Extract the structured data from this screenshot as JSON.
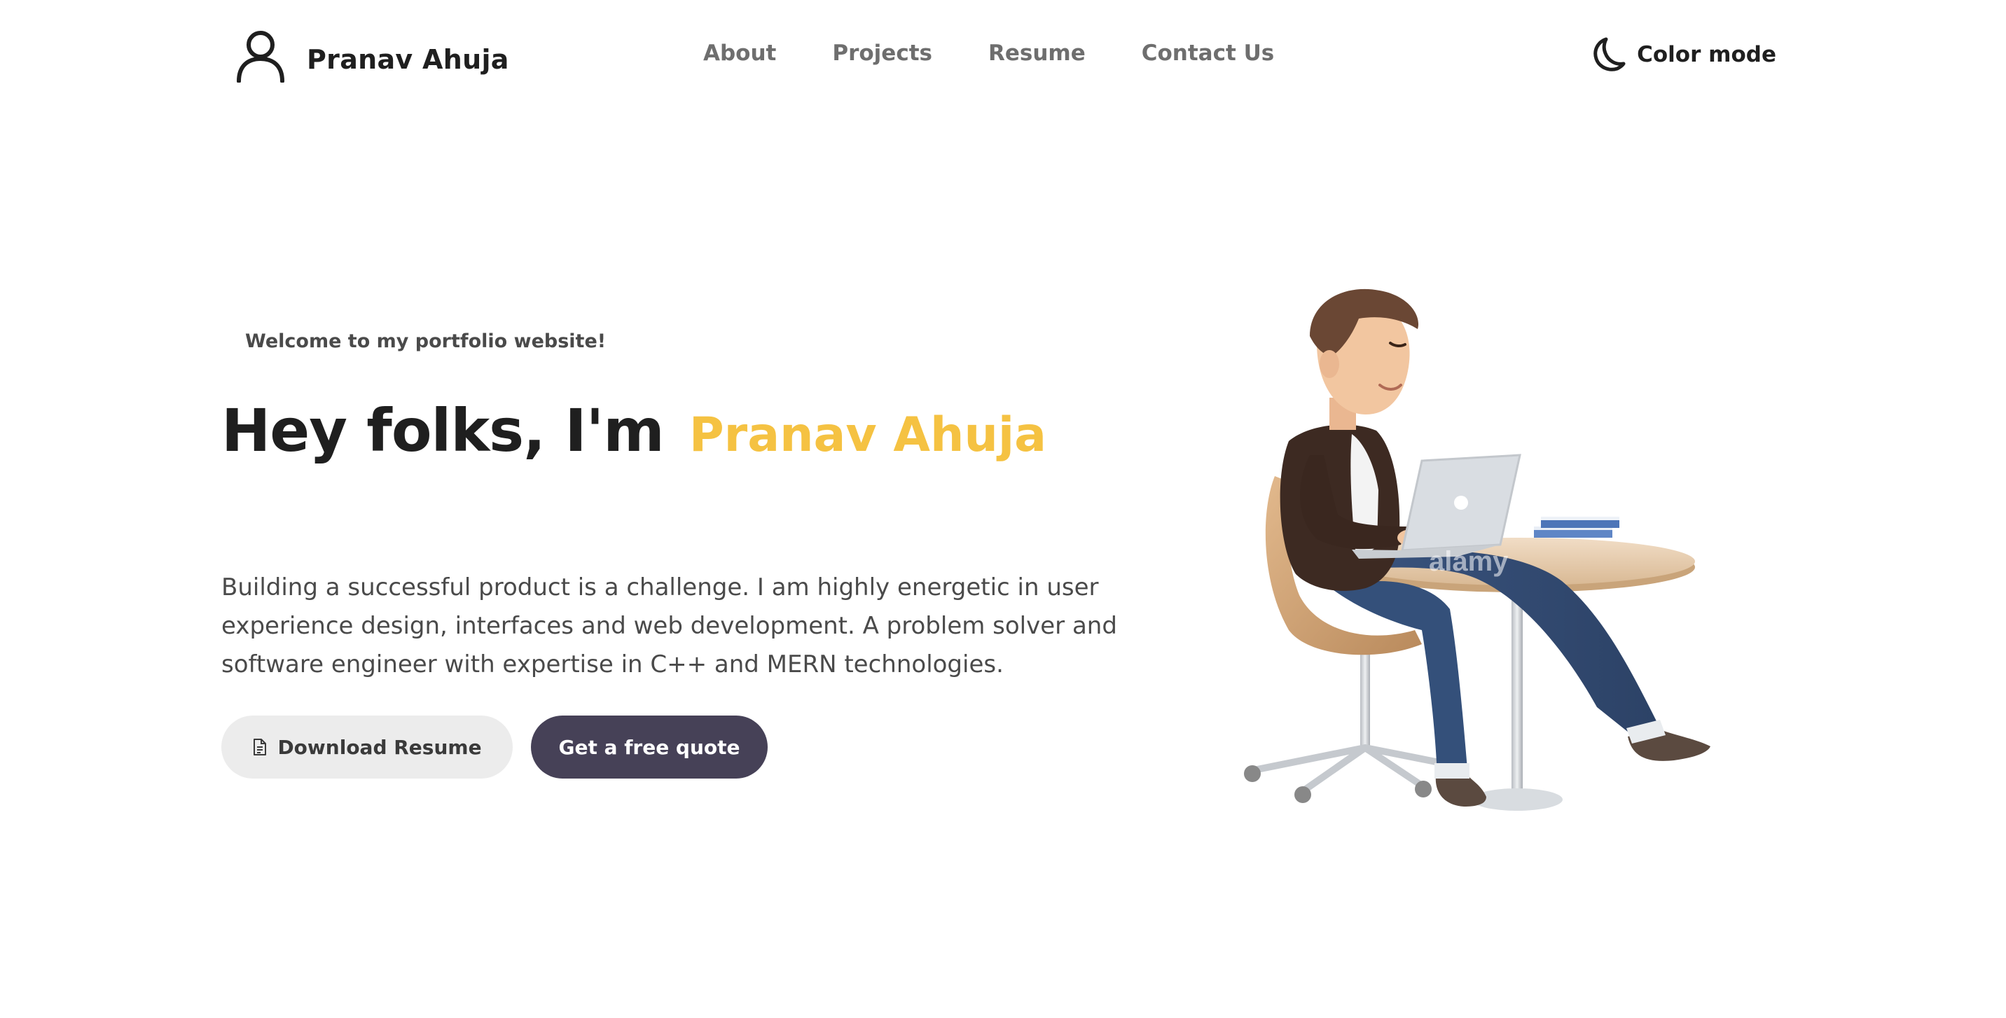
{
  "header": {
    "brand_name": "Pranav Ahuja",
    "brand_icon": "user-icon",
    "nav": [
      {
        "label": "About"
      },
      {
        "label": "Projects"
      },
      {
        "label": "Resume"
      },
      {
        "label": "Contact Us"
      }
    ],
    "color_mode": {
      "label": "Color mode",
      "icon": "moon-icon"
    }
  },
  "hero": {
    "welcome": "Welcome to my portfolio website!",
    "title_lead": "Hey folks, I'm",
    "title_name": "Pranav Ahuja",
    "description": "Building a successful product is a challenge. I am highly energetic in user experience design, interfaces and web development. A problem solver and software engineer with expertise in C++ and MERN technologies.",
    "buttons": {
      "download_resume": "Download Resume",
      "get_quote": "Get a free quote"
    },
    "illustration_watermark": "alamy"
  },
  "colors": {
    "accent_yellow": "#f5c242",
    "button_dark": "#464157",
    "button_light": "#ececec",
    "nav_text": "#6e6e6e"
  }
}
